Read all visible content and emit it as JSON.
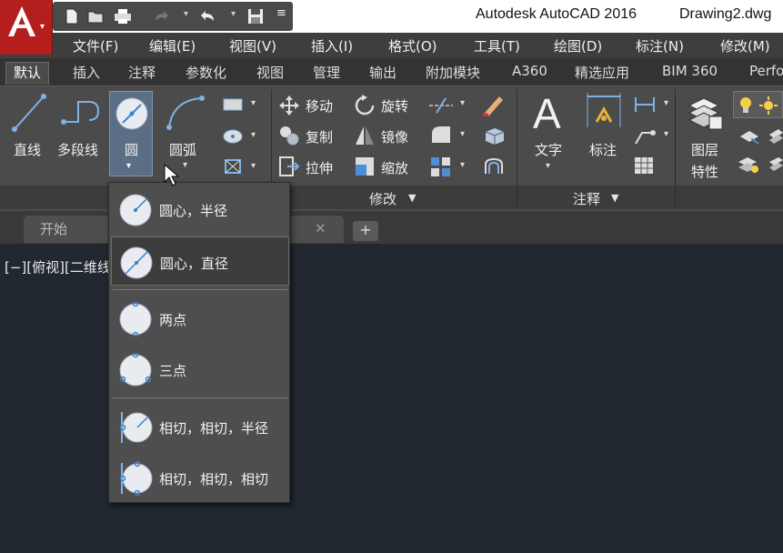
{
  "app": {
    "title": "Autodesk AutoCAD 2016",
    "document": "Drawing2.dwg"
  },
  "menubar": [
    "文件(F)",
    "编辑(E)",
    "视图(V)",
    "插入(I)",
    "格式(O)",
    "工具(T)",
    "绘图(D)",
    "标注(N)",
    "修改(M)"
  ],
  "ribbon_tabs": [
    "默认",
    "插入",
    "注释",
    "参数化",
    "视图",
    "管理",
    "输出",
    "附加模块",
    "A360",
    "精选应用",
    "BIM 360",
    "Perfo"
  ],
  "draw_panel": {
    "line": "直线",
    "polyline": "多段线",
    "circle": "圆",
    "arc": "圆弧"
  },
  "modify_panel": {
    "move": "移动",
    "rotate": "旋转",
    "copy": "复制",
    "mirror": "镜像",
    "stretch": "拉伸",
    "scale": "缩放",
    "label": "修改"
  },
  "annotation_panel": {
    "text": "文字",
    "dimension": "标注",
    "label": "注释"
  },
  "layers_panel": {
    "layer_props_line1": "图层",
    "layer_props_line2": "特性"
  },
  "doc_tabs": {
    "start": "开始"
  },
  "viewport_label": "[−][俯视][二维线框]",
  "circle_menu": [
    {
      "label": "圆心，半径",
      "icon": "circle-center-radius-icon"
    },
    {
      "label": "圆心，直径",
      "icon": "circle-center-diameter-icon",
      "hover": true
    },
    {
      "label": "两点",
      "icon": "circle-two-point-icon"
    },
    {
      "label": "三点",
      "icon": "circle-three-point-icon"
    },
    {
      "label": "相切，相切，半径",
      "icon": "circle-ttr-icon"
    },
    {
      "label": "相切，相切，相切",
      "icon": "circle-ttt-icon"
    }
  ],
  "colors": {
    "accent": "#b41e1e",
    "ribbon": "#4b4b4b",
    "canvas": "#212830",
    "selected": "#5a6e86"
  }
}
